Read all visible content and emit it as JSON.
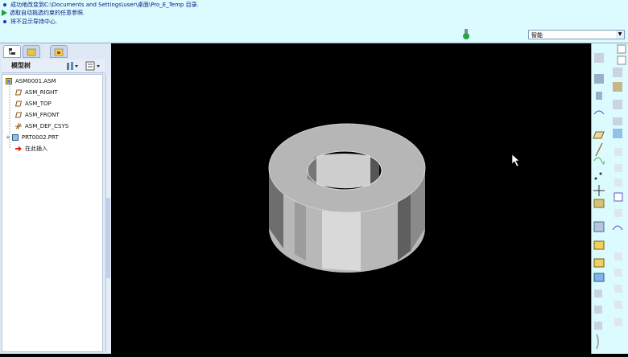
{
  "messages": [
    {
      "icon": "info-dot-icon",
      "text": "成功地改变到C:\\Documents and Settings\\user\\桌面\\Pro_E_Temp 目录."
    },
    {
      "icon": "prompt-arrow-icon",
      "text": "选取自动挑选约束的任意参照."
    },
    {
      "icon": "info-dot-icon",
      "text": "将不显示导持中心."
    }
  ],
  "filter": {
    "value": "智能"
  },
  "navigator": {
    "tabs": [
      "model-tree-tab",
      "folder-browser-tab",
      "favorites-tab"
    ],
    "title": "模型树",
    "items": [
      {
        "icon": "assembly-icon",
        "label": "ASM0001.ASM"
      },
      {
        "icon": "datum-plane-icon",
        "label": "ASM_RIGHT"
      },
      {
        "icon": "datum-plane-icon",
        "label": "ASM_TOP"
      },
      {
        "icon": "datum-plane-icon",
        "label": "ASM_FRONT"
      },
      {
        "icon": "coordinate-system-icon",
        "label": "ASM_DEF_CSYS"
      },
      {
        "icon": "part-icon",
        "label": "PRT0002.PRT"
      },
      {
        "icon": "insert-here-arrow-icon",
        "label": "在此插入"
      }
    ]
  },
  "colors": {
    "message_bg": "#dcfbff",
    "viewport_bg": "#000000",
    "panel_bg": "#dfe9f5",
    "accent_blue": "#1738c9"
  }
}
